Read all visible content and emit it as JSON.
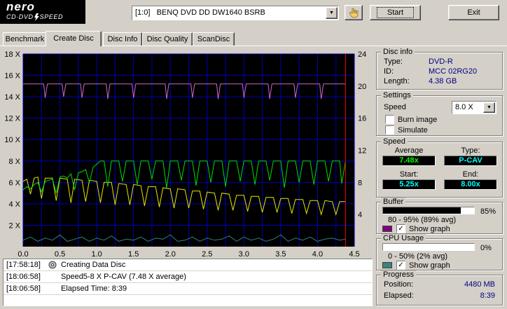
{
  "icons": {
    "dropdown_arrow": "▼",
    "checkbox_check": "✓"
  },
  "header": {
    "logo": {
      "brand": "nero",
      "product_left": "CD·DVD",
      "product_right": "SPEED"
    },
    "drive_select": {
      "value": "[1:0]   BENQ DVD DD DW1640 BSRB"
    },
    "start_label": "Start",
    "exit_label": "Exit"
  },
  "tabs": [
    {
      "label": "Benchmark",
      "active": false
    },
    {
      "label": "Create Disc",
      "active": true
    },
    {
      "label": "Disc Info",
      "active": false
    },
    {
      "label": "Disc Quality",
      "active": false
    },
    {
      "label": "ScanDisc",
      "active": false
    }
  ],
  "chart_data": {
    "type": "line",
    "plot_bg": "#000000",
    "grid_color": "#0000b4",
    "end_marker_x": 4.38,
    "end_marker_color": "#ff0000",
    "x_axis": {
      "min": 0,
      "max": 4.5,
      "step": 0.5,
      "grid_step": 0.25,
      "labels": [
        "0.0",
        "0.5",
        "1.0",
        "1.5",
        "2.0",
        "2.5",
        "3.0",
        "3.5",
        "4.0",
        "4.5"
      ]
    },
    "y_left": {
      "min": 0,
      "max": 18,
      "step": 2,
      "labels": [
        "2 X",
        "4 X",
        "6 X",
        "8 X",
        "10 X",
        "12 X",
        "14 X",
        "16 X",
        "18 X"
      ]
    },
    "y_right": {
      "min": 0,
      "max": 24,
      "step": 4,
      "labels": [
        "4",
        "8",
        "12",
        "16",
        "20",
        "24"
      ]
    },
    "series": [
      {
        "name": "buffer-level",
        "color": "#cc66cc",
        "points": [
          [
            0,
            15.2
          ],
          [
            0.28,
            15.2
          ],
          [
            0.3,
            13.9
          ],
          [
            0.33,
            15.2
          ],
          [
            0.53,
            15.2
          ],
          [
            0.55,
            14.0
          ],
          [
            0.58,
            15.2
          ],
          [
            0.78,
            15.2
          ],
          [
            0.8,
            13.9
          ],
          [
            0.83,
            15.2
          ],
          [
            1.13,
            15.2
          ],
          [
            1.15,
            13.8
          ],
          [
            1.18,
            15.2
          ],
          [
            1.48,
            15.2
          ],
          [
            1.5,
            13.9
          ],
          [
            1.53,
            15.2
          ],
          [
            1.93,
            15.2
          ],
          [
            1.95,
            13.8
          ],
          [
            1.98,
            15.2
          ],
          [
            2.28,
            15.2
          ],
          [
            2.3,
            13.9
          ],
          [
            2.33,
            15.2
          ],
          [
            2.63,
            15.2
          ],
          [
            2.65,
            13.8
          ],
          [
            2.68,
            15.2
          ],
          [
            2.98,
            15.2
          ],
          [
            3.0,
            13.9
          ],
          [
            3.03,
            15.2
          ],
          [
            3.33,
            15.2
          ],
          [
            3.35,
            13.8
          ],
          [
            3.38,
            15.2
          ],
          [
            3.68,
            15.2
          ],
          [
            3.7,
            13.9
          ],
          [
            3.73,
            15.2
          ],
          [
            4.03,
            15.2
          ],
          [
            4.05,
            13.8
          ],
          [
            4.08,
            15.2
          ],
          [
            4.38,
            15.2
          ]
        ]
      },
      {
        "name": "cpu-usage",
        "color": "#2f8080",
        "points": [
          [
            0,
            0.6
          ],
          [
            0.1,
            0.9
          ],
          [
            0.2,
            0.5
          ],
          [
            0.3,
            0.8
          ],
          [
            0.4,
            0.6
          ],
          [
            0.5,
            1.1
          ],
          [
            0.6,
            0.5
          ],
          [
            0.7,
            0.7
          ],
          [
            0.8,
            0.9
          ],
          [
            0.9,
            0.5
          ],
          [
            1.0,
            0.8
          ],
          [
            1.1,
            0.6
          ],
          [
            1.2,
            1.0
          ],
          [
            1.3,
            0.5
          ],
          [
            1.4,
            0.7
          ],
          [
            1.5,
            0.6
          ],
          [
            1.6,
            0.9
          ],
          [
            1.7,
            0.5
          ],
          [
            1.8,
            0.8
          ],
          [
            1.9,
            0.7
          ],
          [
            2.0,
            1.1
          ],
          [
            2.1,
            0.5
          ],
          [
            2.2,
            0.6
          ],
          [
            2.3,
            0.9
          ],
          [
            2.4,
            0.5
          ],
          [
            2.5,
            0.8
          ],
          [
            2.6,
            0.6
          ],
          [
            2.7,
            0.7
          ],
          [
            2.8,
            1.0
          ],
          [
            2.9,
            0.5
          ],
          [
            3.0,
            0.9
          ],
          [
            3.1,
            0.6
          ],
          [
            3.2,
            0.8
          ],
          [
            3.3,
            0.5
          ],
          [
            3.4,
            0.7
          ],
          [
            3.5,
            1.1
          ],
          [
            3.6,
            0.5
          ],
          [
            3.7,
            0.8
          ],
          [
            3.8,
            0.6
          ],
          [
            3.9,
            0.9
          ],
          [
            4.0,
            0.5
          ],
          [
            4.1,
            0.7
          ],
          [
            4.2,
            0.8
          ],
          [
            4.3,
            0.6
          ],
          [
            4.38,
            0.7
          ]
        ]
      },
      {
        "name": "secondary-speed",
        "color": "#e6e600",
        "points": [
          [
            0,
            6.1
          ],
          [
            0.05,
            6.3
          ],
          [
            0.1,
            4.9
          ],
          [
            0.15,
            6.4
          ],
          [
            0.2,
            6.5
          ],
          [
            0.25,
            4.5
          ],
          [
            0.3,
            6.4
          ],
          [
            0.4,
            6.4
          ],
          [
            0.45,
            4.3
          ],
          [
            0.5,
            6.4
          ],
          [
            0.6,
            6.3
          ],
          [
            0.65,
            4.1
          ],
          [
            0.7,
            6.3
          ],
          [
            0.8,
            6.2
          ],
          [
            0.85,
            4.2
          ],
          [
            0.9,
            6.2
          ],
          [
            1.0,
            6.1
          ],
          [
            1.05,
            4.1
          ],
          [
            1.1,
            6.0
          ],
          [
            1.2,
            6.0
          ],
          [
            1.25,
            3.9
          ],
          [
            1.3,
            5.9
          ],
          [
            1.4,
            5.8
          ],
          [
            1.45,
            3.9
          ],
          [
            1.5,
            5.8
          ],
          [
            1.6,
            5.7
          ],
          [
            1.65,
            3.8
          ],
          [
            1.7,
            5.6
          ],
          [
            1.8,
            5.6
          ],
          [
            1.85,
            3.7
          ],
          [
            1.9,
            5.5
          ],
          [
            2.0,
            5.4
          ],
          [
            2.05,
            3.6
          ],
          [
            2.1,
            5.4
          ],
          [
            2.2,
            5.3
          ],
          [
            2.25,
            3.6
          ],
          [
            2.3,
            5.2
          ],
          [
            2.4,
            5.2
          ],
          [
            2.45,
            3.5
          ],
          [
            2.5,
            5.1
          ],
          [
            2.6,
            5.0
          ],
          [
            2.65,
            3.4
          ],
          [
            2.7,
            5.0
          ],
          [
            2.8,
            4.9
          ],
          [
            2.85,
            3.4
          ],
          [
            2.9,
            4.8
          ],
          [
            3.0,
            4.8
          ],
          [
            3.05,
            3.3
          ],
          [
            3.1,
            4.7
          ],
          [
            3.2,
            4.7
          ],
          [
            3.25,
            3.2
          ],
          [
            3.3,
            4.6
          ],
          [
            3.4,
            4.6
          ],
          [
            3.45,
            3.2
          ],
          [
            3.5,
            4.5
          ],
          [
            3.6,
            4.5
          ],
          [
            3.65,
            3.1
          ],
          [
            3.7,
            4.4
          ],
          [
            3.8,
            4.4
          ],
          [
            3.85,
            3.1
          ],
          [
            3.9,
            4.3
          ],
          [
            4.0,
            4.3
          ],
          [
            4.05,
            3.0
          ],
          [
            4.1,
            4.3
          ],
          [
            4.2,
            4.2
          ],
          [
            4.25,
            3.0
          ],
          [
            4.3,
            4.2
          ],
          [
            4.38,
            4.2
          ]
        ]
      },
      {
        "name": "write-speed",
        "color": "#00dd00",
        "points": [
          [
            0,
            5.3
          ],
          [
            0.05,
            5.6
          ],
          [
            0.1,
            5.4
          ],
          [
            0.15,
            5.8
          ],
          [
            0.2,
            6.0
          ],
          [
            0.25,
            5.1
          ],
          [
            0.3,
            6.1
          ],
          [
            0.35,
            6.2
          ],
          [
            0.4,
            6.3
          ],
          [
            0.45,
            5.0
          ],
          [
            0.5,
            6.5
          ],
          [
            0.55,
            6.6
          ],
          [
            0.6,
            6.4
          ],
          [
            0.65,
            6.8
          ],
          [
            0.7,
            5.3
          ],
          [
            0.75,
            6.9
          ],
          [
            0.8,
            7.0
          ],
          [
            0.85,
            7.2
          ],
          [
            0.9,
            6.0
          ],
          [
            0.95,
            7.4
          ],
          [
            1.0,
            7.7
          ],
          [
            1.05,
            8.0
          ],
          [
            1.1,
            8.0
          ],
          [
            1.15,
            5.6
          ],
          [
            1.2,
            8.0
          ],
          [
            1.3,
            8.0
          ],
          [
            1.35,
            6.1
          ],
          [
            1.4,
            8.0
          ],
          [
            1.5,
            8.0
          ],
          [
            1.55,
            5.8
          ],
          [
            1.6,
            8.0
          ],
          [
            1.7,
            8.0
          ],
          [
            1.75,
            6.3
          ],
          [
            1.8,
            8.0
          ],
          [
            1.9,
            8.0
          ],
          [
            1.95,
            5.5
          ],
          [
            2.0,
            8.0
          ],
          [
            2.1,
            8.0
          ],
          [
            2.15,
            6.2
          ],
          [
            2.2,
            8.0
          ],
          [
            2.3,
            8.0
          ],
          [
            2.35,
            5.7
          ],
          [
            2.4,
            8.0
          ],
          [
            2.5,
            8.0
          ],
          [
            2.55,
            6.0
          ],
          [
            2.6,
            8.0
          ],
          [
            2.7,
            8.0
          ],
          [
            2.75,
            5.6
          ],
          [
            2.8,
            8.0
          ],
          [
            2.9,
            8.0
          ],
          [
            2.95,
            6.1
          ],
          [
            3.0,
            8.0
          ],
          [
            3.1,
            8.0
          ],
          [
            3.15,
            5.8
          ],
          [
            3.2,
            8.0
          ],
          [
            3.3,
            8.0
          ],
          [
            3.35,
            6.2
          ],
          [
            3.4,
            8.0
          ],
          [
            3.5,
            8.0
          ],
          [
            3.55,
            5.5
          ],
          [
            3.6,
            8.0
          ],
          [
            3.7,
            8.0
          ],
          [
            3.75,
            6.0
          ],
          [
            3.8,
            8.0
          ],
          [
            3.9,
            8.0
          ],
          [
            3.95,
            5.8
          ],
          [
            4.0,
            8.0
          ],
          [
            4.1,
            8.0
          ],
          [
            4.15,
            6.1
          ],
          [
            4.2,
            8.0
          ],
          [
            4.3,
            8.0
          ],
          [
            4.33,
            5.9
          ],
          [
            4.38,
            8.0
          ]
        ]
      }
    ]
  },
  "log": [
    {
      "time": "[17:58:18]",
      "text": "Creating Data Disc",
      "has_icon": true
    },
    {
      "time": "[18:06:58]",
      "text": "Speed5-8 X P-CAV (7.48 X average)",
      "has_icon": false
    },
    {
      "time": "[18:06:58]",
      "text": "Elapsed Time: 8:39",
      "has_icon": false
    }
  ],
  "panel": {
    "disc_info": {
      "title": "Disc info",
      "rows": [
        {
          "label": "Type:",
          "value": "DVD-R"
        },
        {
          "label": "ID:",
          "value": "MCC 02RG20"
        },
        {
          "label": "Length:",
          "value": "4.38 GB"
        }
      ]
    },
    "settings": {
      "title": "Settings",
      "speed_label": "Speed",
      "speed_value": "8.0 X",
      "checkboxes": [
        {
          "label": "Burn image",
          "checked": false
        },
        {
          "label": "Simulate",
          "checked": false
        }
      ]
    },
    "speed": {
      "title": "Speed",
      "average_label": "Average",
      "average_value": "7.48x",
      "average_color": "#00ff00",
      "type_label": "Type:",
      "type_value": "P-CAV",
      "start_label": "Start:",
      "start_value": "5.25x",
      "end_label": "End:",
      "end_value": "8.00x",
      "value_color": "#00ffff"
    },
    "buffer": {
      "title": "Buffer",
      "percent": 85,
      "percent_label": "85%",
      "range_label": "80 - 95% (89% avg)",
      "swatch_color": "#800080",
      "show_graph_label": "Show graph",
      "show_graph_checked": true
    },
    "cpu": {
      "title": "CPU Usage",
      "percent": 0,
      "percent_label": "0%",
      "range_label": "0 - 50% (2% avg)",
      "swatch_color": "#408080",
      "show_graph_label": "Show graph",
      "show_graph_checked": true
    },
    "progress": {
      "title": "Progress",
      "rows": [
        {
          "label": "Position:",
          "value": "4480 MB"
        },
        {
          "label": "Elapsed:",
          "value": "8:39"
        }
      ]
    }
  }
}
